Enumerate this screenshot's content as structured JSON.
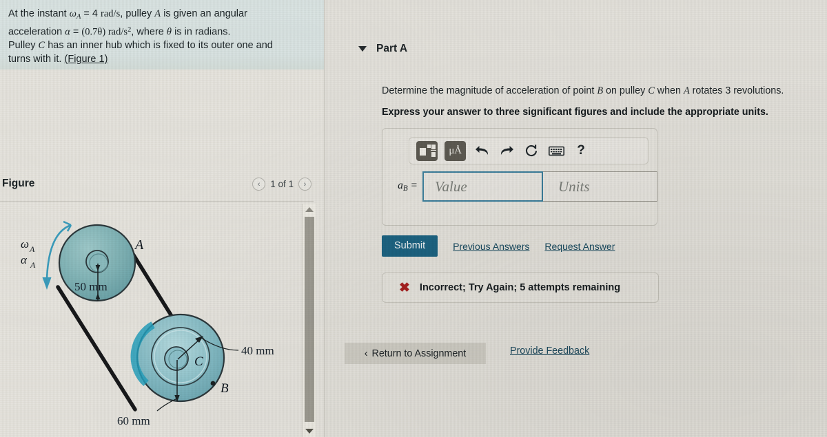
{
  "problem": {
    "line1_a": "At the instant ",
    "omega": "ω",
    "sub_A": "A",
    "line1_b": " = 4 ",
    "units_rads": "rad/s",
    "line1_c": ", pulley ",
    "pulley_A": "A",
    "line1_d": " is given an angular",
    "line2_a": "acceleration ",
    "alpha": "α",
    "line2_eq": " = ",
    "line2_val": "(0.7θ) rad/s",
    "line2_exp": "2",
    "line2_b": ", where ",
    "theta": "θ",
    "line2_c": " is in radians.",
    "line3_a": "Pulley ",
    "pulley_C": "C",
    "line3_b": " has an inner hub which is fixed to its outer one and",
    "line4_a": "turns with it. ",
    "figure_link": "(Figure 1)"
  },
  "figure": {
    "title": "Figure",
    "nav_prev": "‹",
    "nav_next": "›",
    "counter": "1 of 1",
    "labels": {
      "omega_A": "ω",
      "omega_A_sub": "A",
      "alpha_A": "α",
      "alpha_A_sub": "A",
      "pulley_A": "A",
      "pulley_C": "C",
      "point_B": "B",
      "dim_50": "50 mm",
      "dim_40": "40 mm",
      "dim_60": "60 mm"
    },
    "colors": {
      "pulley_fill": "#7fb3b6",
      "pulley_stroke": "#2d3b3f",
      "belt": "#1c1c1c",
      "arrow_teal": "#2e95b8"
    }
  },
  "part_a": {
    "caret": "▼",
    "title": "Part A",
    "question": "Determine the magnitude of acceleration of point B on pulley C when A rotates 3 revolutions.",
    "question_parts": {
      "p1": "Determine the magnitude of acceleration of point ",
      "B": "B",
      "p2": " on pulley ",
      "C": "C",
      "p3": " when ",
      "A": "A",
      "p4": " rotates 3 revolutions."
    },
    "hint": "Express your answer to three significant figures and include the appropriate units."
  },
  "toolbar": {
    "template_icon": "math-template-icon",
    "units_label": "μÅ",
    "undo_icon": "↩",
    "redo_icon": "↪",
    "reset_icon": "↻",
    "keyboard_icon": "keyboard-icon",
    "help_label": "?"
  },
  "answer": {
    "label_var": "a",
    "label_sub": "B",
    "label_eq": " =",
    "value_placeholder": "Value",
    "units_placeholder": "Units",
    "value": "",
    "units": ""
  },
  "actions": {
    "submit": "Submit",
    "previous_answers": "Previous Answers",
    "request_answer": "Request Answer",
    "return_to_assignment": "Return to Assignment",
    "return_chevron": "‹",
    "provide_feedback": "Provide Feedback"
  },
  "feedback": {
    "icon": "✖",
    "text": "Incorrect; Try Again; 5 attempts remaining",
    "color": "#a82020"
  },
  "scrollbar": {
    "up_arrow": "▲",
    "down_arrow": "▼"
  },
  "theme": {
    "page_bg": "#e3e1db",
    "statement_bg": "#dae4e3",
    "submit_bg": "#1c6382",
    "link_color": "#17495f",
    "focus_border": "#3b7e9c"
  }
}
